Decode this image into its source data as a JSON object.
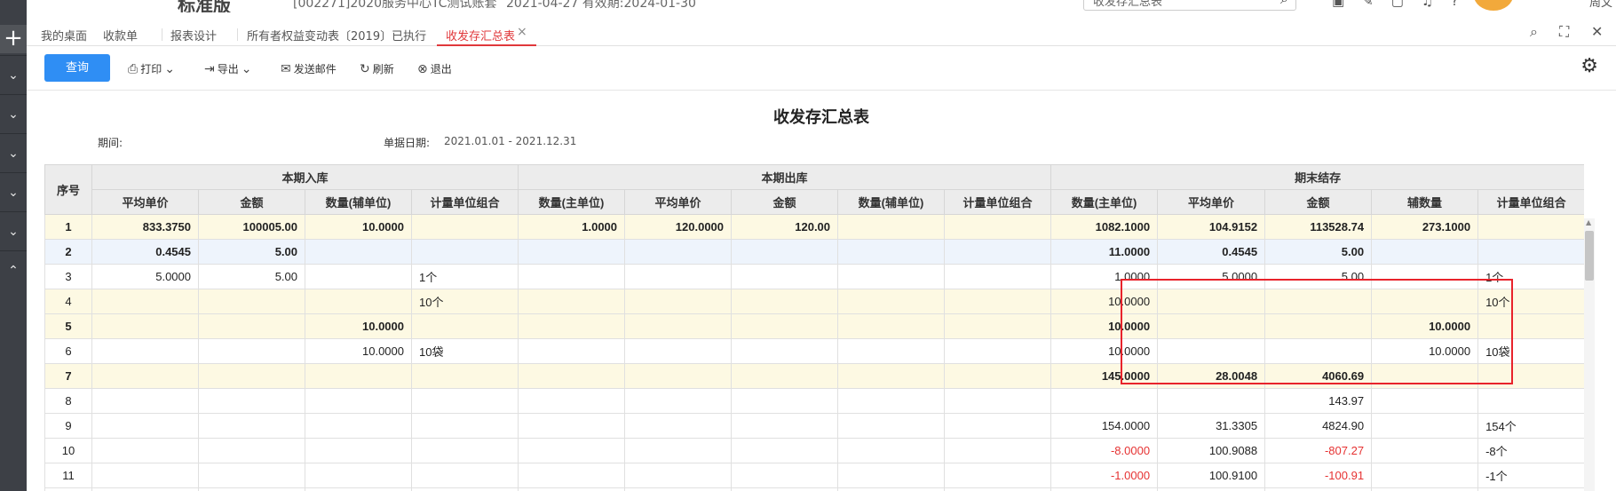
{
  "header": {
    "logo": "标准版",
    "company": "[002271]2020服务中心TC测试账套",
    "dates": "2021-04-27   有效期:2024-01-30",
    "search_placeholder": "收发存汇总表",
    "user": "周文静"
  },
  "tabs": [
    {
      "label": "我的桌面"
    },
    {
      "label": "收款单"
    },
    {
      "label": "报表设计"
    },
    {
      "label": "所有者权益变动表〔2019〕已执行"
    },
    {
      "label": "收发存汇总表"
    }
  ],
  "toolbar": {
    "query": "查询",
    "print": "打印",
    "export": "导出",
    "send_mail": "发送邮件",
    "refresh": "刷新",
    "exit": "退出"
  },
  "report": {
    "title": "收发存汇总表",
    "period_label": "期间:",
    "date_label": "单据日期:",
    "date_value": "2021.01.01 - 2021.12.31"
  },
  "table": {
    "seq_header": "序号",
    "groups": [
      "本期入库",
      "本期出库",
      "期末结存"
    ],
    "columns": [
      "平均单价",
      "金额",
      "数量(辅单位)",
      "计量单位组合",
      "数量(主单位)",
      "平均单价",
      "金额",
      "数量(辅单位)",
      "计量单位组合",
      "数量(主单位)",
      "平均单价",
      "金额",
      "辅数量",
      "计量单位组合"
    ],
    "rows": [
      {
        "seq": "1",
        "cells": [
          "833.3750",
          "100005.00",
          "10.0000",
          "",
          "1.0000",
          "120.0000",
          "120.00",
          "",
          "",
          "1082.1000",
          "104.9152",
          "113528.74",
          "273.1000",
          ""
        ]
      },
      {
        "seq": "2",
        "cells": [
          "0.4545",
          "5.00",
          "",
          "",
          "",
          "",
          "",
          "",
          "",
          "11.0000",
          "0.4545",
          "5.00",
          "",
          ""
        ]
      },
      {
        "seq": "3",
        "cells": [
          "5.0000",
          "5.00",
          "",
          "1个",
          "",
          "",
          "",
          "",
          "",
          "1.0000",
          "5.0000",
          "5.00",
          "",
          "1个"
        ]
      },
      {
        "seq": "4",
        "cells": [
          "",
          "",
          "",
          "10个",
          "",
          "",
          "",
          "",
          "",
          "10.0000",
          "",
          "",
          "",
          "10个"
        ]
      },
      {
        "seq": "5",
        "cells": [
          "",
          "",
          "10.0000",
          "",
          "",
          "",
          "",
          "",
          "",
          "10.0000",
          "",
          "",
          "10.0000",
          ""
        ]
      },
      {
        "seq": "6",
        "cells": [
          "",
          "",
          "10.0000",
          "10袋",
          "",
          "",
          "",
          "",
          "",
          "10.0000",
          "",
          "",
          "10.0000",
          "10袋"
        ]
      },
      {
        "seq": "7",
        "cells": [
          "",
          "",
          "",
          "",
          "",
          "",
          "",
          "",
          "",
          "145.0000",
          "28.0048",
          "4060.69",
          "",
          ""
        ]
      },
      {
        "seq": "8",
        "cells": [
          "",
          "",
          "",
          "",
          "",
          "",
          "",
          "",
          "",
          "",
          "",
          "143.97",
          "",
          ""
        ]
      },
      {
        "seq": "9",
        "cells": [
          "",
          "",
          "",
          "",
          "",
          "",
          "",
          "",
          "",
          "154.0000",
          "31.3305",
          "4824.90",
          "",
          "154个"
        ]
      },
      {
        "seq": "10",
        "cells": [
          "",
          "",
          "",
          "",
          "",
          "",
          "",
          "",
          "",
          "-8.0000",
          "100.9088",
          "-807.27",
          "",
          "-8个"
        ]
      },
      {
        "seq": "11",
        "cells": [
          "",
          "",
          "",
          "",
          "",
          "",
          "",
          "",
          "",
          "-1.0000",
          "100.9100",
          "-100.91",
          "",
          "-1个"
        ]
      },
      {
        "seq": "",
        "cells": [
          "",
          "",
          "",
          "",
          "",
          "",
          "",
          "",
          "",
          "",
          "",
          "",
          "",
          ""
        ]
      }
    ]
  },
  "colors": {
    "accent": "#2f8ef4",
    "active_tab": "#e0383b",
    "negative": "#e63232",
    "highlight_box": "#e8232b"
  }
}
